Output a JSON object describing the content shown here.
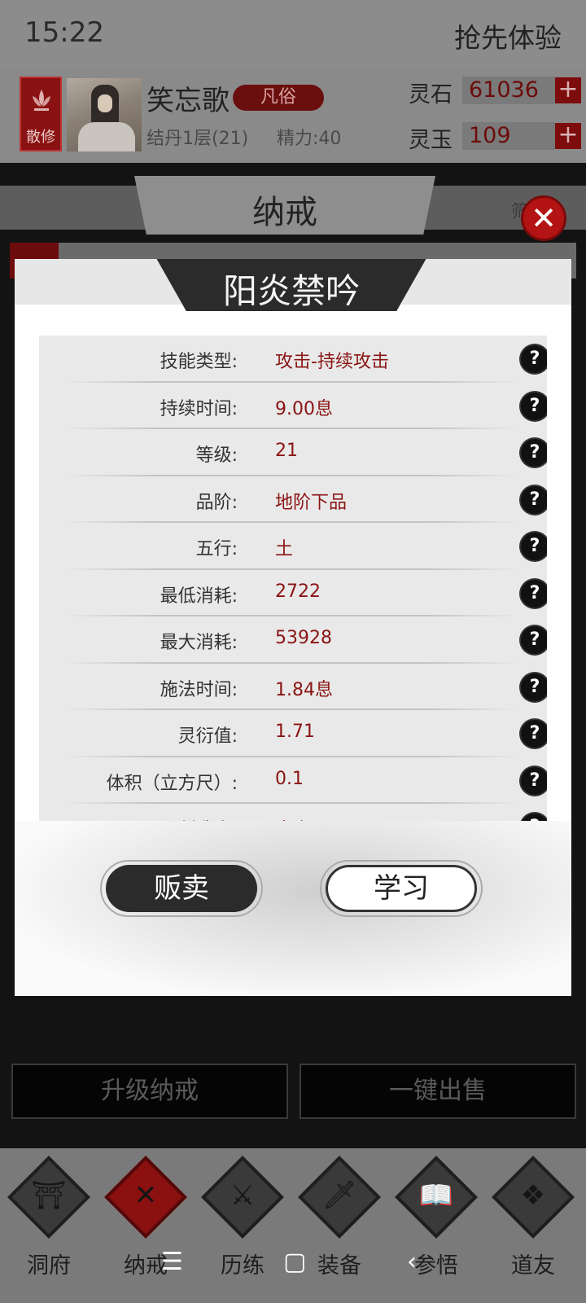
{
  "status": {
    "time": "15:22",
    "first_experience": "抢先体验"
  },
  "player": {
    "rank_badge": "散修",
    "name": "笑忘歌",
    "realm_tag": "凡俗",
    "cultivation": "结丹1层(21)",
    "energy": "精力:40",
    "currencies": [
      {
        "label": "灵石",
        "value": "61036"
      },
      {
        "label": "灵玉",
        "value": "109"
      }
    ]
  },
  "screen": {
    "title": "纳戒",
    "filter": "筛"
  },
  "dialog": {
    "title": "阳炎禁吟",
    "attributes": [
      {
        "label": "技能类型:",
        "value": "攻击-持续攻击"
      },
      {
        "label": "持续时间:",
        "value": "9.00息"
      },
      {
        "label": "等级:",
        "value": "21"
      },
      {
        "label": "品阶:",
        "value": "地阶下品"
      },
      {
        "label": "五行:",
        "value": "土"
      },
      {
        "label": "最低消耗:",
        "value": "2722"
      },
      {
        "label": "最大消耗:",
        "value": "53928"
      },
      {
        "label": "施法时间:",
        "value": "1.84息"
      },
      {
        "label": "灵衍值:",
        "value": "1.71"
      },
      {
        "label": "体积（立方尺）:",
        "value": "0.1"
      },
      {
        "label": "创造人:",
        "value": "青虚"
      }
    ],
    "sell_label": "贩卖",
    "learn_label": "学习"
  },
  "actions": {
    "upgrade": "升级纳戒",
    "sell_all": "一键出售"
  },
  "nav": [
    {
      "label": "洞府",
      "icon": "gate-icon"
    },
    {
      "label": "纳戒",
      "icon": "ring-icon"
    },
    {
      "label": "历练",
      "icon": "swords-icon"
    },
    {
      "label": "装备",
      "icon": "dagger-icon"
    },
    {
      "label": "参悟",
      "icon": "book-icon"
    },
    {
      "label": "道友",
      "icon": "handshake-icon"
    }
  ],
  "colors": {
    "accent_red": "#8b1010",
    "value_red": "#8a1414",
    "dialog_bg": "#ffffff"
  }
}
